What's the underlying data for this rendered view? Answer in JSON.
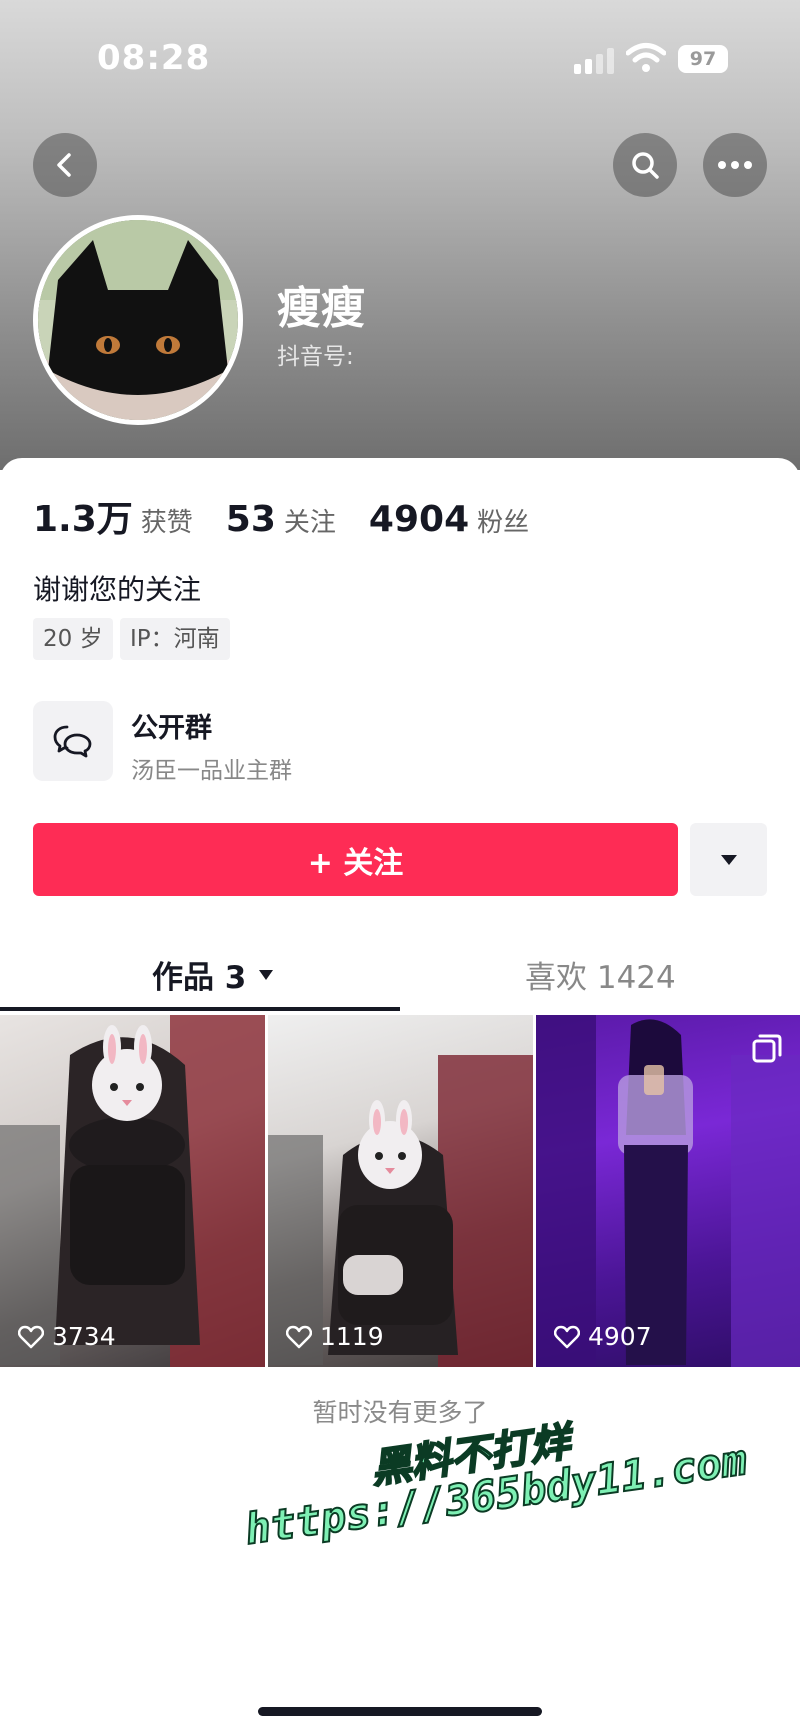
{
  "status_bar": {
    "time": "08:28",
    "battery": "97"
  },
  "profile": {
    "nickname": "瘦瘦",
    "douyin_id_label": "抖音号:",
    "stats": [
      {
        "value": "1.3万",
        "label": "获赞"
      },
      {
        "value": "53",
        "label": "关注"
      },
      {
        "value": "4904",
        "label": "粉丝"
      }
    ],
    "bio": "谢谢您的关注",
    "tags": [
      "20 岁",
      "IP：河南"
    ]
  },
  "group": {
    "title": "公开群",
    "subtitle": "汤臣一品业主群"
  },
  "actions": {
    "follow_label": "+ 关注"
  },
  "tabs": {
    "works": "作品 3",
    "likes": "喜欢 1424"
  },
  "videos": [
    {
      "likes": "3734"
    },
    {
      "likes": "1119"
    },
    {
      "likes": "4907"
    }
  ],
  "footer_text": "暂时没有更多了",
  "watermark": {
    "line1": "黑料不打烊",
    "line2": "https://365bdy11.com"
  },
  "colors": {
    "accent": "#fe2c55"
  }
}
